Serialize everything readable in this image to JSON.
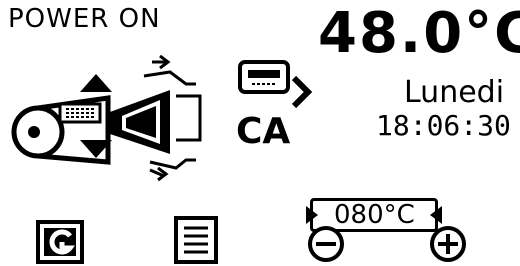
{
  "status": {
    "label": "POWER ON"
  },
  "temperature": {
    "value": "48.0°C"
  },
  "schedule": {
    "mode": "CA"
  },
  "clock": {
    "day": "Lunedi",
    "time": "18:06:30"
  },
  "setpoint": {
    "value": "080°C"
  },
  "icons": {
    "burner": "pellet-burner-icon",
    "fan_up": "arrow-up-icon",
    "fan_down": "arrow-down-icon",
    "chrono": "chrono-display-icon",
    "back": "back-icon",
    "menu": "menu-icon",
    "minus": "minus-icon",
    "plus": "plus-icon"
  },
  "colors": {
    "foreground": "#000000",
    "background": "#ffffff"
  }
}
